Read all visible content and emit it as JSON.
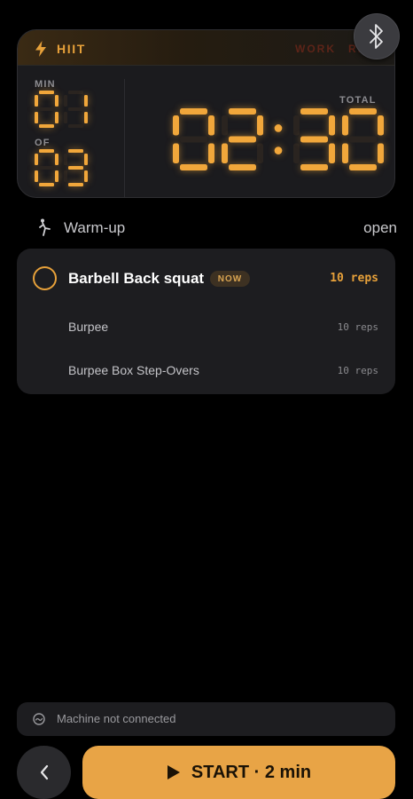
{
  "timer": {
    "mode_label": "HIIT",
    "mode_icon": "lightning-bolt-icon",
    "phase_labels": [
      "WORK",
      "REST"
    ],
    "round_label": "MIN",
    "round_current": "01",
    "of_label": "OF",
    "round_total": "03",
    "total_label": "TOTAL",
    "total_time": "02:30",
    "accent_color": "#f1a73b"
  },
  "bluetooth_button": {
    "icon": "bluetooth-icon"
  },
  "warmup": {
    "icon": "stretching-figure-icon",
    "label": "Warm-up",
    "action": "open"
  },
  "exercises": [
    {
      "name": "Barbell Back squat",
      "badge": "NOW",
      "reps": "10 reps",
      "active": true
    },
    {
      "name": "Burpee",
      "reps": "10 reps",
      "active": false
    },
    {
      "name": "Burpee Box Step-Overs",
      "reps": "10 reps",
      "active": false
    }
  ],
  "machine": {
    "icon": "gauge-icon",
    "status": "Machine not connected"
  },
  "footer": {
    "back_icon": "chevron-left-icon",
    "start_icon": "play-icon",
    "start_label": "START · 2 min",
    "start_color": "#e8a446"
  }
}
